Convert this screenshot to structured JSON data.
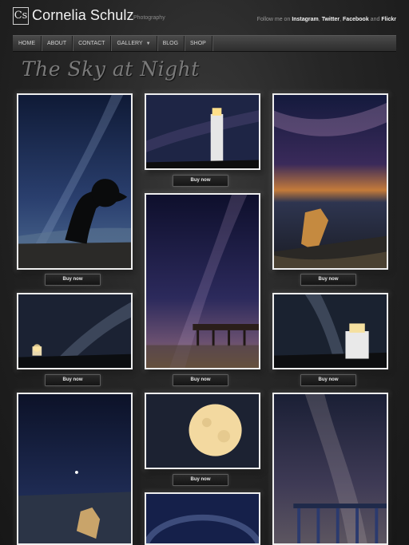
{
  "header": {
    "logo_text": "Cs",
    "site_title": "Cornelia Schulz",
    "site_subtitle": "Photography",
    "follow_prefix": "Follow me on",
    "social": [
      "Instagram",
      "Twitter",
      "Facebook",
      "Flickr"
    ],
    "sep_comma": ",",
    "sep_and": "and"
  },
  "nav": {
    "items": [
      "HOME",
      "ABOUT",
      "CONTACT",
      "GALLERY",
      "BLOG",
      "SHOP"
    ]
  },
  "page_title": "The Sky at Night",
  "buy_label": "Buy now",
  "photos": [
    {
      "subject": "milky-way-tree"
    },
    {
      "subject": "lighthouse-night"
    },
    {
      "subject": "coastal-rocks-milky-way"
    },
    {
      "subject": "milky-way-lighthouse-small"
    },
    {
      "subject": "milky-way-jetty"
    },
    {
      "subject": "milky-way-white-lighthouse"
    },
    {
      "subject": "starry-sky-rock"
    },
    {
      "subject": "full-moon"
    },
    {
      "subject": "milky-way-arch"
    },
    {
      "subject": "milky-way-pier"
    }
  ],
  "colors": {
    "sky_deep": "#0d1530",
    "sky_purple": "#3a2a5a",
    "moon": "#f3d9a0"
  }
}
